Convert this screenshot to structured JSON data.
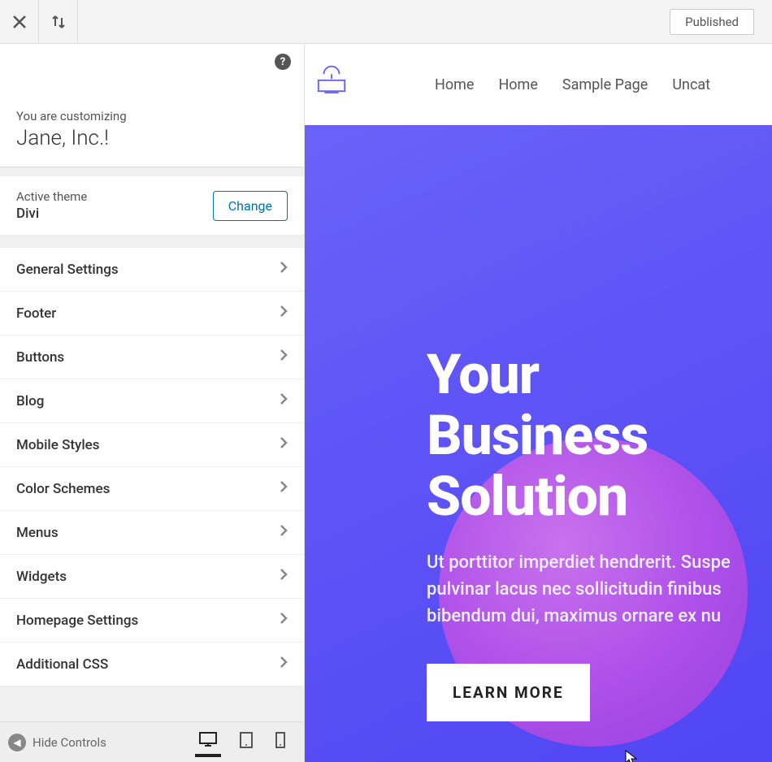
{
  "topbar": {
    "status": "Published"
  },
  "header": {
    "sub": "You are customizing",
    "title": "Jane, Inc.!"
  },
  "theme": {
    "label": "Active theme",
    "name": "Divi",
    "change": "Change"
  },
  "menu": [
    "General Settings",
    "Footer",
    "Buttons",
    "Blog",
    "Mobile Styles",
    "Color Schemes",
    "Menus",
    "Widgets",
    "Homepage Settings",
    "Additional CSS"
  ],
  "footer": {
    "hide": "Hide Controls"
  },
  "site": {
    "nav": [
      "Home",
      "Home",
      "Sample Page",
      "Uncat"
    ],
    "hero_title_1": "Your Business",
    "hero_title_2": "Solution",
    "hero_text": "Ut porttitor imperdiet hendrerit. Suspe pulvinar lacus nec sollicitudin finibus bibendum dui, maximus ornare ex nu",
    "hero_btn": "LEARN MORE"
  }
}
